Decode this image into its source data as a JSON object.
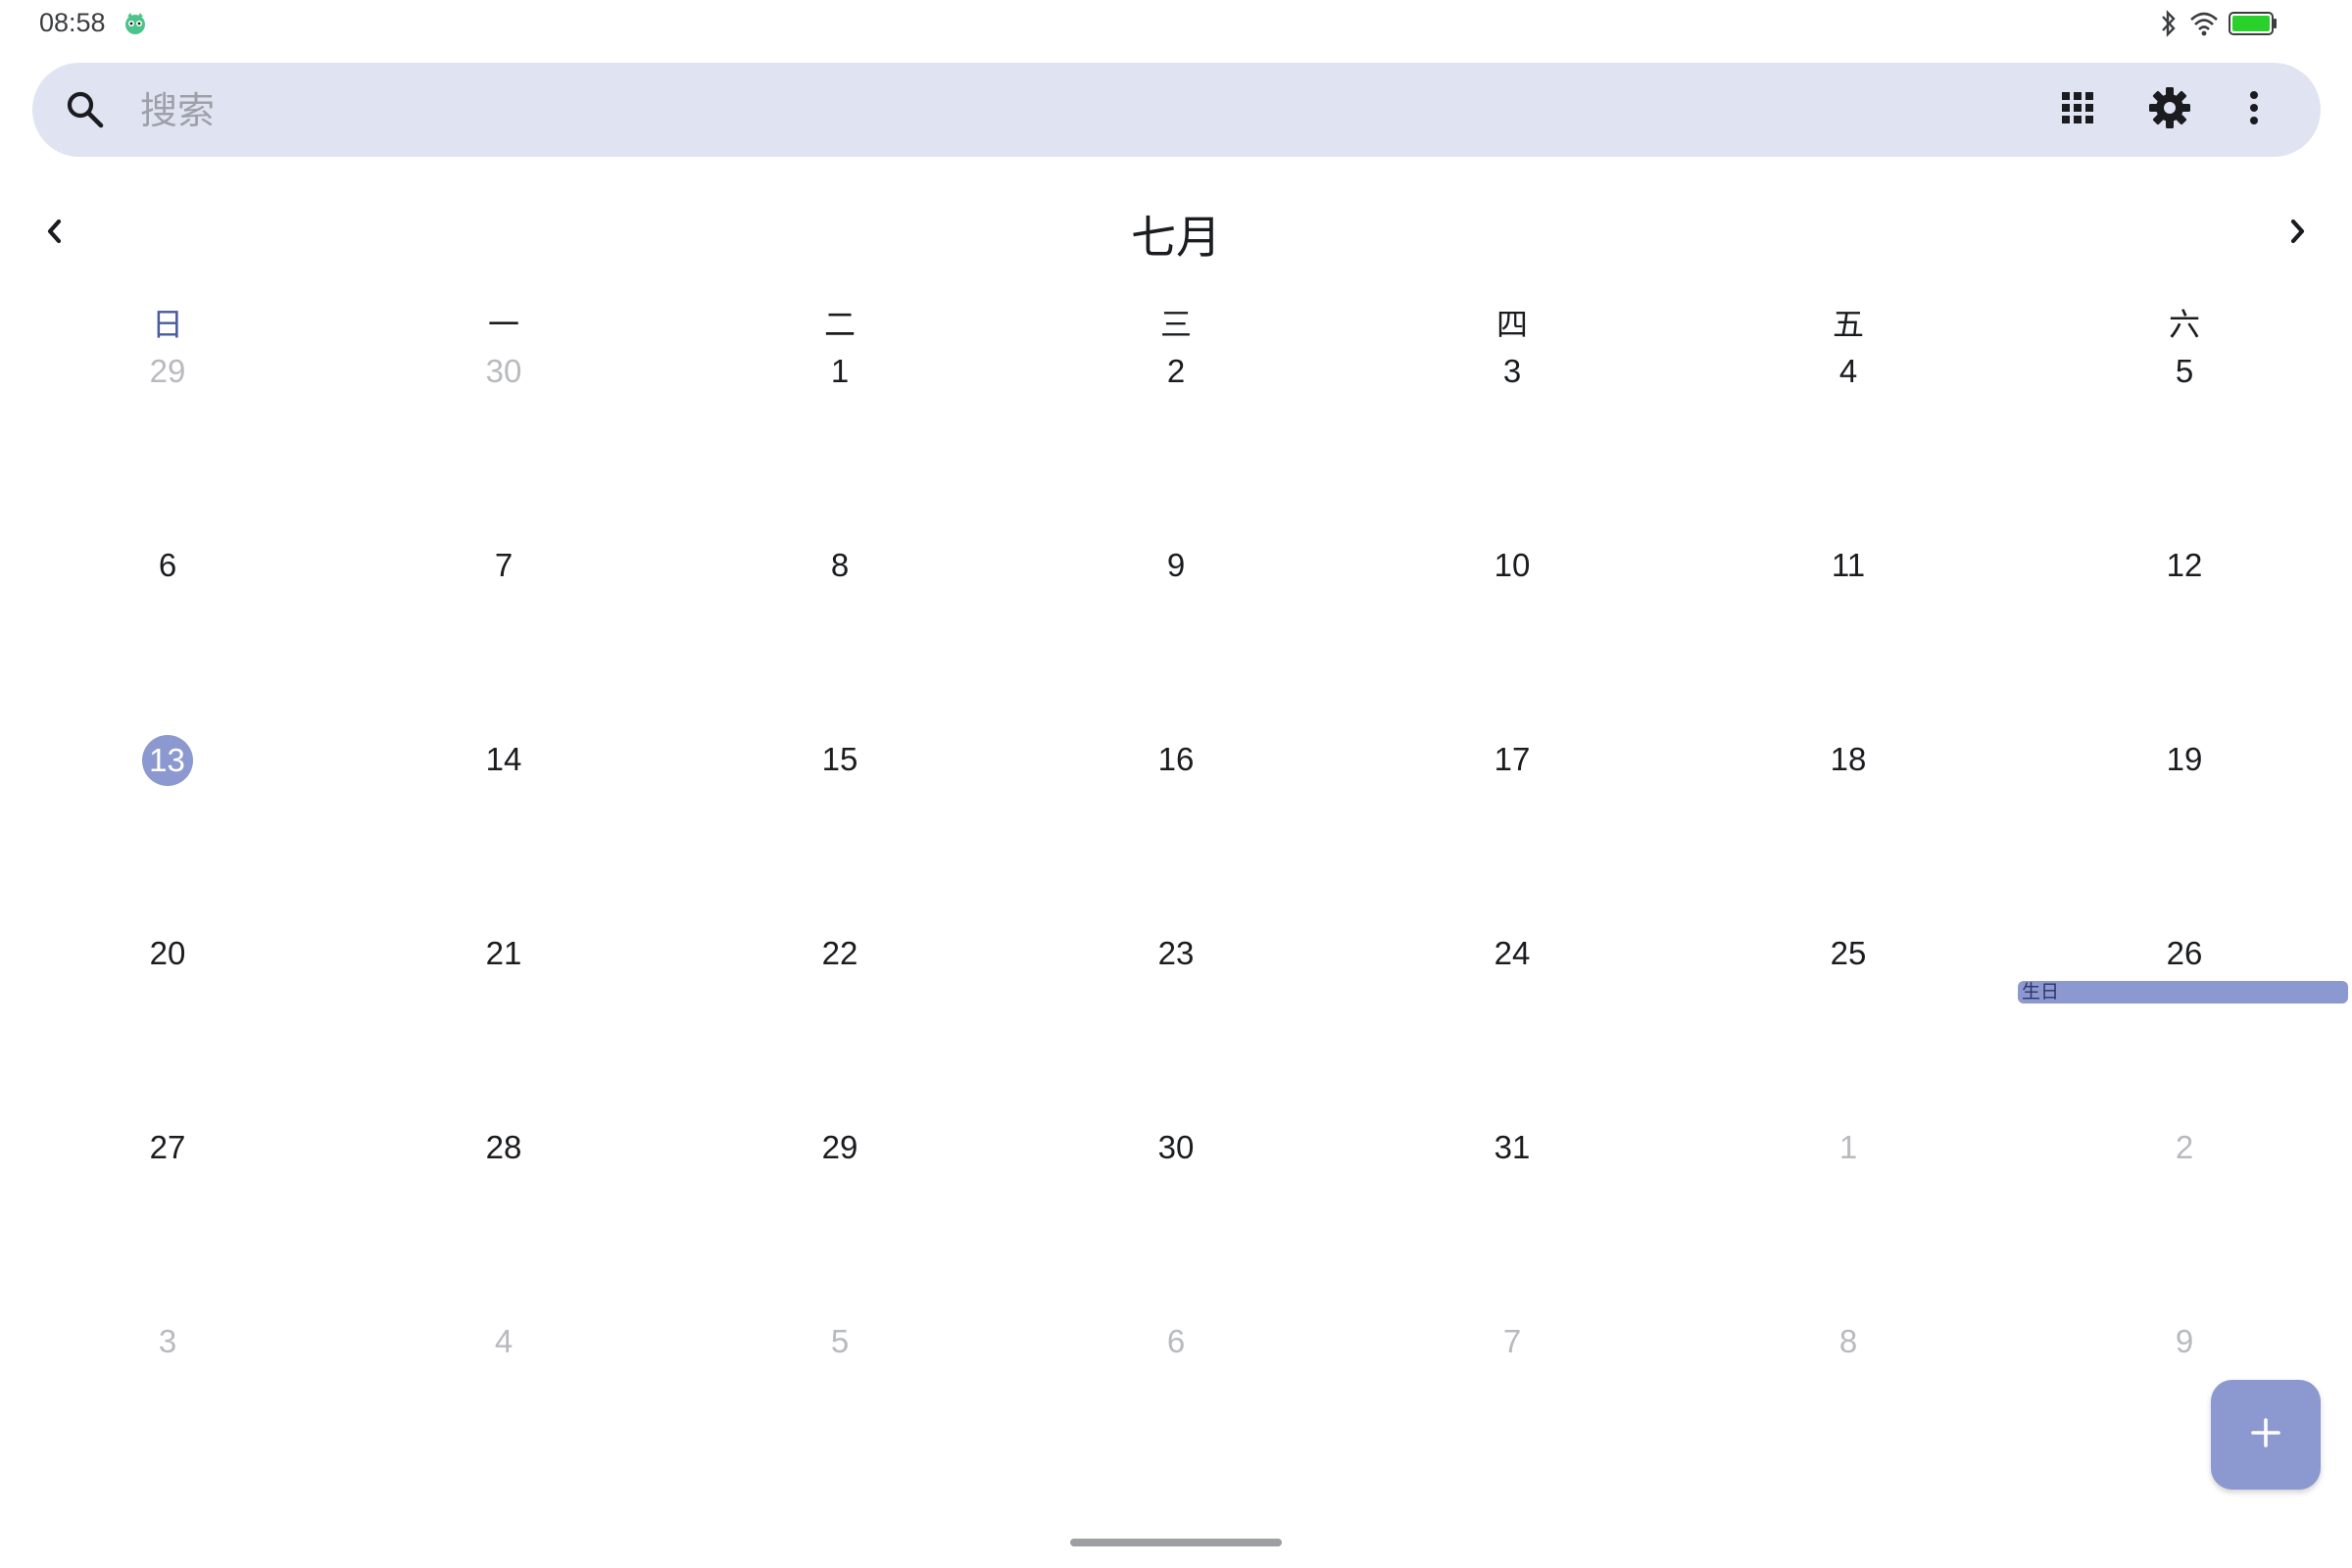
{
  "status_bar": {
    "time": "08:58",
    "icons": [
      "bluetooth-icon",
      "wifi-icon",
      "battery-icon"
    ],
    "battery_color": "#2bd12b"
  },
  "search": {
    "placeholder": "搜索",
    "value": ""
  },
  "toolbar": {
    "icons": [
      "apps-grid-icon",
      "gear-icon",
      "more-vert-icon"
    ]
  },
  "calendar": {
    "month_title": "七月",
    "weekdays": [
      "日",
      "一",
      "二",
      "三",
      "四",
      "五",
      "六"
    ],
    "weeks": [
      [
        {
          "d": "29",
          "o": true
        },
        {
          "d": "30",
          "o": true
        },
        {
          "d": "1"
        },
        {
          "d": "2"
        },
        {
          "d": "3"
        },
        {
          "d": "4"
        },
        {
          "d": "5"
        }
      ],
      [
        {
          "d": "6"
        },
        {
          "d": "7"
        },
        {
          "d": "8"
        },
        {
          "d": "9"
        },
        {
          "d": "10"
        },
        {
          "d": "11"
        },
        {
          "d": "12"
        }
      ],
      [
        {
          "d": "13",
          "today": true
        },
        {
          "d": "14"
        },
        {
          "d": "15"
        },
        {
          "d": "16"
        },
        {
          "d": "17"
        },
        {
          "d": "18"
        },
        {
          "d": "19"
        }
      ],
      [
        {
          "d": "20"
        },
        {
          "d": "21"
        },
        {
          "d": "22"
        },
        {
          "d": "23"
        },
        {
          "d": "24"
        },
        {
          "d": "25"
        },
        {
          "d": "26"
        }
      ],
      [
        {
          "d": "27"
        },
        {
          "d": "28"
        },
        {
          "d": "29"
        },
        {
          "d": "30"
        },
        {
          "d": "31"
        },
        {
          "d": "1",
          "o": true
        },
        {
          "d": "2",
          "o": true
        }
      ],
      [
        {
          "d": "3",
          "o": true
        },
        {
          "d": "4",
          "o": true
        },
        {
          "d": "5",
          "o": true
        },
        {
          "d": "6",
          "o": true
        },
        {
          "d": "7",
          "o": true
        },
        {
          "d": "8",
          "o": true
        },
        {
          "d": "9",
          "o": true
        }
      ]
    ],
    "events": [
      {
        "title": "生日",
        "date": "26"
      }
    ],
    "accent_color": "#8c98d0"
  },
  "fab": {
    "icon": "plus-icon"
  }
}
